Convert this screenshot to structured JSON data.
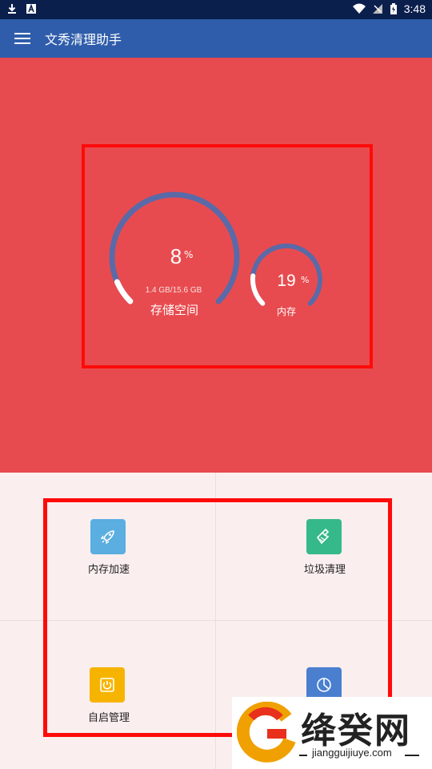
{
  "status_bar": {
    "time": "3:48",
    "icons_left": [
      "download-icon",
      "app-notification-icon"
    ],
    "icons_right": [
      "wifi-icon",
      "signal-icon",
      "battery-icon"
    ]
  },
  "app_bar": {
    "title": "文秀清理助手",
    "menu_icon": "hamburger-menu-icon"
  },
  "colors": {
    "app_bar": "#2f5dab",
    "hero_bg": "#e84b4f",
    "gauge_track": "#5a6aa8",
    "gauge_fill": "#ffffff",
    "annotation": "#ff0a0a"
  },
  "storage": {
    "percent": 8,
    "value_text": "8",
    "unit": "%",
    "detail": "1.4 GB/15.6 GB",
    "label": "存储空间"
  },
  "memory": {
    "percent": 19,
    "value_text": "19",
    "unit": "%",
    "label": "内存"
  },
  "tools": [
    {
      "label": "内存加速",
      "icon": "rocket-icon",
      "color": "#5aaee0"
    },
    {
      "label": "垃圾清理",
      "icon": "broom-icon",
      "color": "#36b98a"
    },
    {
      "label": "自启管理",
      "icon": "power-icon",
      "color": "#f6b400"
    },
    {
      "label": "",
      "icon": "pie-chart-icon",
      "color": "#4a7fd0"
    }
  ],
  "watermark": {
    "brand": "绛癸网",
    "url": "jiangguijiuye.com"
  }
}
